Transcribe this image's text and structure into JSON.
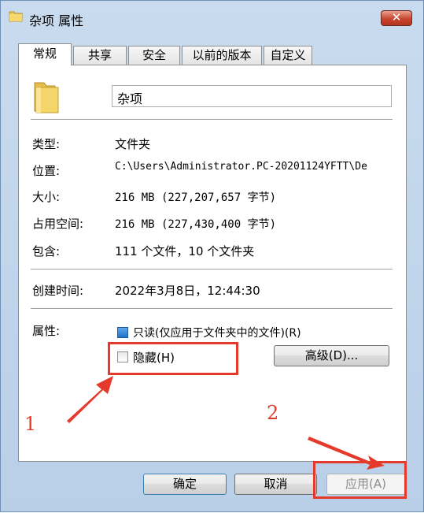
{
  "window": {
    "title": "杂项 属性",
    "close_label": "✕"
  },
  "tabs": [
    {
      "label": "常规",
      "active": true
    },
    {
      "label": "共享",
      "active": false
    },
    {
      "label": "安全",
      "active": false
    },
    {
      "label": "以前的版本",
      "active": false
    },
    {
      "label": "自定义",
      "active": false
    }
  ],
  "general": {
    "folder_name": "杂项",
    "type_label": "类型:",
    "type_value": "文件夹",
    "location_label": "位置:",
    "location_value": "C:\\Users\\Administrator.PC-20201124YFTT\\De",
    "size_label": "大小:",
    "size_value": "216 MB (227,207,657 字节)",
    "disk_size_label": "占用空间:",
    "disk_size_value": "216 MB (227,430,400 字节)",
    "contains_label": "包含:",
    "contains_value": "111 个文件，10 个文件夹",
    "created_label": "创建时间:",
    "created_value": "2022年3月8日，12:44:30",
    "attributes_label": "属性:",
    "readonly_label": "只读(仅应用于文件夹中的文件)(R)",
    "hidden_label": "隐藏(H)",
    "advanced_label": "高级(D)..."
  },
  "buttons": {
    "ok": "确定",
    "cancel": "取消",
    "apply": "应用(A)"
  },
  "annotations": {
    "marker_1": "1",
    "marker_2": "2",
    "color": "#e53a2b"
  },
  "colors": {
    "accent": "#1e73c8",
    "close": "#c8452f",
    "highlight": "#e53a2b"
  }
}
